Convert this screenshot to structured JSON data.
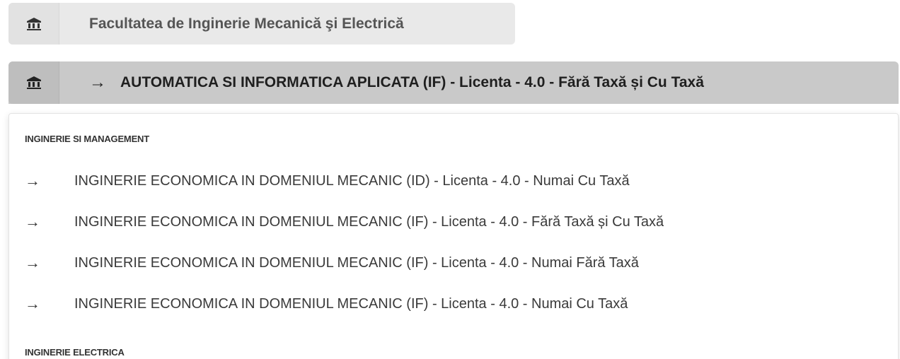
{
  "faculty_select": {
    "icon": "university-icon",
    "label": "Facultatea de Inginerie Mecanică şi Electrică"
  },
  "program_select": {
    "icon": "university-icon",
    "arrow": "→",
    "label": "AUTOMATICA SI INFORMATICA APLICATA (IF) - Licenta - 4.0 - Fără Taxă și Cu Taxă"
  },
  "dropdown": {
    "groups": [
      {
        "header": "INGINERIE SI MANAGEMENT",
        "options": [
          {
            "arrow": "→",
            "label": "INGINERIE ECONOMICA IN DOMENIUL MECANIC (ID) - Licenta - 4.0 - Numai Cu Taxă"
          },
          {
            "arrow": "→",
            "label": "INGINERIE ECONOMICA IN DOMENIUL MECANIC (IF) - Licenta - 4.0 - Fără Taxă și Cu Taxă"
          },
          {
            "arrow": "→",
            "label": "INGINERIE ECONOMICA IN DOMENIUL MECANIC (IF) - Licenta - 4.0 - Numai Fără Taxă"
          },
          {
            "arrow": "→",
            "label": "INGINERIE ECONOMICA IN DOMENIUL MECANIC (IF) - Licenta - 4.0 - Numai Cu Taxă"
          }
        ]
      },
      {
        "header": "INGINERIE ELECTRICA",
        "options": []
      }
    ]
  }
}
